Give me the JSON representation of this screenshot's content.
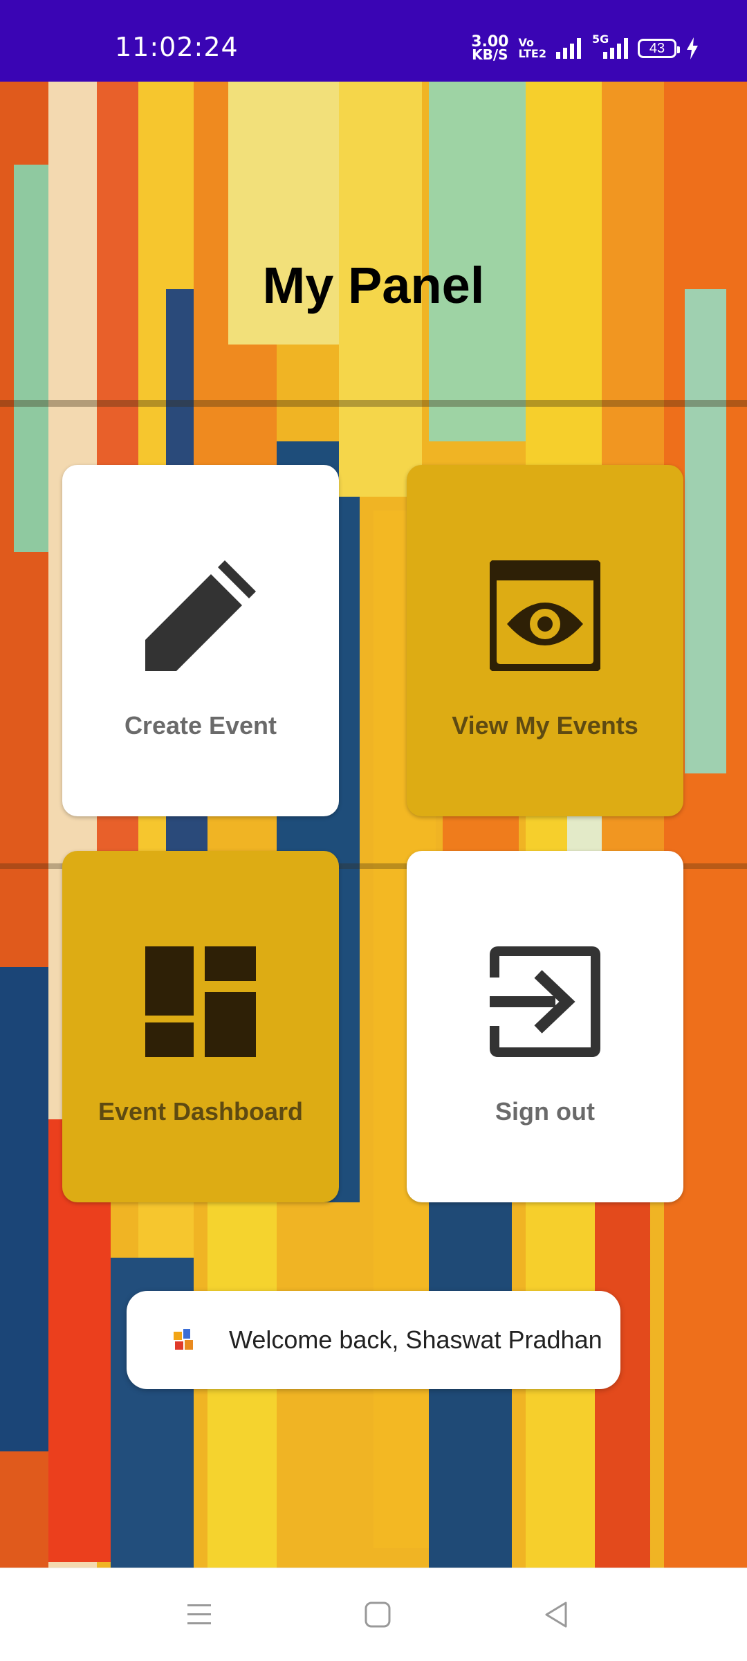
{
  "status_bar": {
    "time": "11:02:24",
    "net_speed_value": "3.00",
    "net_speed_unit": "KB/S",
    "volte_top": "Vo",
    "volte_bottom": "LTE2",
    "network_type": "5G",
    "battery_level": "43",
    "charging": true
  },
  "page": {
    "title": "My Panel"
  },
  "tiles": [
    {
      "label": "Create Event",
      "icon": "pencil-icon",
      "style": "white"
    },
    {
      "label": "View My Events",
      "icon": "eye-window-icon",
      "style": "gold"
    },
    {
      "label": "Event Dashboard",
      "icon": "dashboard-icon",
      "style": "gold"
    },
    {
      "label": "Sign out",
      "icon": "sign-out-icon",
      "style": "white"
    }
  ],
  "toast": {
    "icon": "app-icon",
    "message": "Welcome back, Shaswat Pradhan"
  },
  "nav_bar": {
    "buttons": [
      "menu-icon",
      "home-icon",
      "back-icon"
    ]
  },
  "colors": {
    "status_bar": "#3a05b4",
    "tile_gold": "#ddac14",
    "tile_white": "#ffffff",
    "icon_dark": "#333333",
    "icon_dark_gold": "#2e2006"
  }
}
